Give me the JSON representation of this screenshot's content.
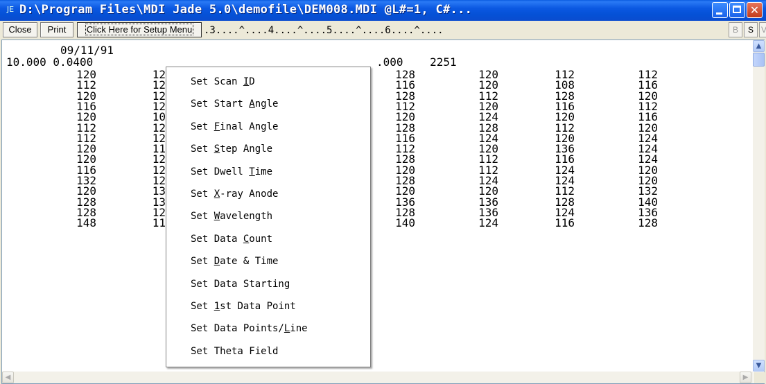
{
  "window": {
    "title": "D:\\Program Files\\MDI Jade 5.0\\demofile\\DEM008.MDI    @L#=1, C#...",
    "icon_name": "jade-app-icon"
  },
  "toolbar": {
    "close_label": "Close",
    "print_label": "Print",
    "setup_label": "Click Here for Setup Menu",
    "ruler": ".3....^....4....^....5....^....6....^....",
    "b_label": "B",
    "s_label": "S",
    "v_label": "V"
  },
  "file": {
    "header_date": "09/11/91",
    "header_line2_left": "10.000 0.0400",
    "header_line2_right": ".000    2251",
    "col1": [
      "120",
      "112",
      "120",
      "116",
      "120",
      "112",
      "112",
      "120",
      "120",
      "116",
      "132",
      "120",
      "128",
      "128",
      "148"
    ],
    "col2": [
      "12",
      "12",
      "12",
      "12",
      "10",
      "12",
      "12",
      "11",
      "12",
      "12",
      "12",
      "13",
      "13",
      "12",
      "11"
    ],
    "col3": [
      "128",
      "116",
      "128",
      "112",
      "120",
      "128",
      "116",
      "112",
      "128",
      "120",
      "128",
      "120",
      "136",
      "128",
      "140"
    ],
    "col4": [
      "120",
      "120",
      "112",
      "120",
      "124",
      "128",
      "124",
      "120",
      "112",
      "112",
      "124",
      "120",
      "136",
      "136",
      "124"
    ],
    "col5": [
      "112",
      "108",
      "128",
      "116",
      "120",
      "112",
      "120",
      "136",
      "116",
      "124",
      "124",
      "112",
      "128",
      "124",
      "116"
    ],
    "col6": [
      "112",
      "116",
      "120",
      "112",
      "116",
      "120",
      "124",
      "124",
      "124",
      "120",
      "120",
      "132",
      "140",
      "136",
      "128"
    ]
  },
  "menu": {
    "items": [
      {
        "pre": "Set Scan ",
        "acc": "I",
        "post": "D"
      },
      {
        "pre": "Set Start ",
        "acc": "A",
        "post": "ngle"
      },
      {
        "pre": "Set ",
        "acc": "F",
        "post": "inal Angle"
      },
      {
        "pre": "Set ",
        "acc": "S",
        "post": "tep Angle"
      },
      {
        "pre": "Set Dwell ",
        "acc": "T",
        "post": "ime"
      },
      {
        "pre": "Set ",
        "acc": "X",
        "post": "-ray Anode"
      },
      {
        "pre": "Set ",
        "acc": "W",
        "post": "avelength"
      },
      {
        "pre": "Set Data ",
        "acc": "C",
        "post": "ount"
      },
      {
        "pre": "Set ",
        "acc": "D",
        "post": "ate & Time"
      },
      {
        "pre": "Set Data Starting",
        "acc": "",
        "post": ""
      },
      {
        "pre": "Set ",
        "acc": "1",
        "post": "st Data Point"
      },
      {
        "pre": "Set Data Points/",
        "acc": "L",
        "post": "ine"
      },
      {
        "pre": "Set Theta Field",
        "acc": "",
        "post": ""
      }
    ]
  }
}
